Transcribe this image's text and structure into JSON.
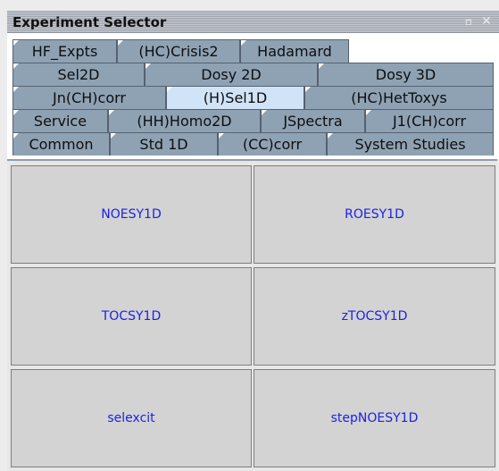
{
  "window": {
    "title": "Experiment Selector",
    "pin_icon": "pin-icon",
    "close_icon": "close-icon",
    "pin_glyph": "▫",
    "close_glyph": "✕"
  },
  "tabs": {
    "row1": [
      "HF_Expts",
      "(HC)Crisis2",
      "Hadamard"
    ],
    "row2": [
      "Sel2D",
      "Dosy 2D",
      "Dosy 3D"
    ],
    "row3": [
      "Jn(CH)corr",
      "(H)Sel1D",
      "(HC)HetToxys"
    ],
    "row4": [
      "Service",
      "(HH)Homo2D",
      "JSpectra",
      "J1(CH)corr"
    ],
    "row5": [
      "Common",
      "Std 1D",
      "(CC)corr",
      "System Studies"
    ],
    "selected": "(H)Sel1D"
  },
  "experiments": [
    "NOESY1D",
    "ROESY1D",
    "TOCSY1D",
    "zTOCSY1D",
    "selexcit",
    "stepNOESY1D"
  ],
  "colors": {
    "tab": "#8fa2b4",
    "tab_selected": "#d1e3f6",
    "button_text": "#1b22e6",
    "button_bg": "#d3d3d3"
  }
}
